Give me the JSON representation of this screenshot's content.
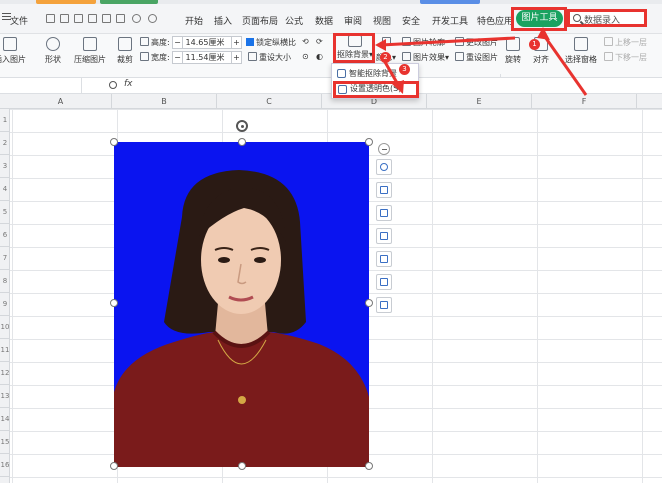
{
  "menubar": {
    "file_label": "文件",
    "items": [
      "开始",
      "插入",
      "页面布局",
      "公式",
      "数据",
      "审阅",
      "视图",
      "安全",
      "开发工具",
      "特色应用"
    ],
    "picture_tools_tab": "图片工具",
    "search_placeholder": "数据录入"
  },
  "ribbon": {
    "insert_picture": "插入图片",
    "shape": "形状",
    "compress_picture": "压缩图片",
    "crop": "裁剪",
    "height_label": "高度:",
    "height_value": "14.65厘米",
    "width_label": "宽度:",
    "width_value": "11.54厘米",
    "lock_ratio": "锁定纵横比",
    "reset_size": "重设大小",
    "remove_bg": "抠除背景",
    "color": "颜色",
    "picture_border": "图片轮廓",
    "picture_effects": "图片效果",
    "change_picture": "更改图片",
    "reset_picture": "重设图片",
    "rotate": "旋转",
    "align": "对齐",
    "select_pane": "选择窗格",
    "bring_forward": "上移一层",
    "send_backward": "下移一层"
  },
  "dropdown": {
    "smart_cutout": "智能抠除背景",
    "set_transparent": "设置透明色(S)"
  },
  "badges": [
    "1",
    "2",
    "3"
  ],
  "formula": {
    "fx_label": "fx"
  },
  "columns": [
    "A",
    "B",
    "C",
    "D",
    "E",
    "F"
  ],
  "rows": [
    "1",
    "2",
    "3",
    "4",
    "5",
    "6",
    "7",
    "8",
    "9",
    "10",
    "11",
    "12",
    "13",
    "14",
    "15",
    "16"
  ],
  "colors": {
    "accent_green": "#1aa260",
    "highlight_red": "#e8332f",
    "photo_background": "#0a14f0",
    "sweater": "#7a1b1b"
  }
}
